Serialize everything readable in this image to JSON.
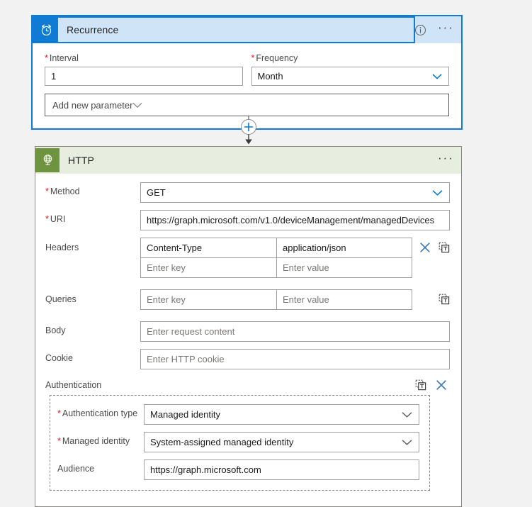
{
  "canvas": {
    "background": "#f2f2f2"
  },
  "colors": {
    "recurrence_accent": "#0f7bd4",
    "recurrence_header_bg": "#cfe4f7",
    "http_accent": "#6f9440",
    "http_header_bg": "#e7eedf",
    "required_star": "#e81123",
    "field_border": "#a19f9d",
    "link_blue": "#0078d4"
  },
  "recurrence": {
    "icon": "alarm-clock-icon",
    "title": "Recurrence",
    "header_icons": [
      "info-icon",
      "more-options-icon"
    ],
    "fields": {
      "interval": {
        "label": "Interval",
        "required": true,
        "value": "1",
        "placeholder": ""
      },
      "frequency": {
        "label": "Frequency",
        "required": true,
        "value": "Month",
        "placeholder": "",
        "chevron": "chevron-down-icon"
      }
    },
    "add_parameter": {
      "label": "Add new parameter",
      "chevron": "chevron-down-icon"
    }
  },
  "connector": {
    "add_icon": "plus-circle-icon",
    "arrow_icon": "arrow-down-icon"
  },
  "http": {
    "icon": "globe-icon",
    "title": "HTTP",
    "header_icons": [
      "more-options-icon"
    ],
    "method": {
      "label": "Method",
      "required": true,
      "value": "GET",
      "chevron": "chevron-down-icon"
    },
    "uri": {
      "label": "URI",
      "required": true,
      "value": "https://graph.microsoft.com/v1.0/deviceManagement/managedDevices"
    },
    "headers": {
      "label": "Headers",
      "rows": [
        {
          "key": "Content-Type",
          "value": "application/json",
          "is_placeholder": false
        },
        {
          "key": "Enter key",
          "value": "Enter value",
          "is_placeholder": true
        }
      ],
      "icons": [
        "delete-icon",
        "dynamic-content-icon"
      ]
    },
    "queries": {
      "label": "Queries",
      "rows": [
        {
          "key": "Enter key",
          "value": "Enter value",
          "is_placeholder": true
        }
      ],
      "icons": [
        "dynamic-content-icon"
      ]
    },
    "body": {
      "label": "Body",
      "value": "",
      "placeholder": "Enter request content"
    },
    "cookie": {
      "label": "Cookie",
      "value": "",
      "placeholder": "Enter HTTP cookie"
    },
    "authentication": {
      "label": "Authentication",
      "icons": [
        "dynamic-content-icon",
        "delete-icon"
      ],
      "fields": {
        "auth_type": {
          "label": "Authentication type",
          "required": true,
          "value": "Managed identity",
          "chevron": "chevron-down-icon"
        },
        "managed_identity": {
          "label": "Managed identity",
          "required": true,
          "value": "System-assigned managed identity",
          "chevron": "chevron-down-icon"
        },
        "audience": {
          "label": "Audience",
          "required": false,
          "value": "https://graph.microsoft.com"
        }
      }
    }
  }
}
